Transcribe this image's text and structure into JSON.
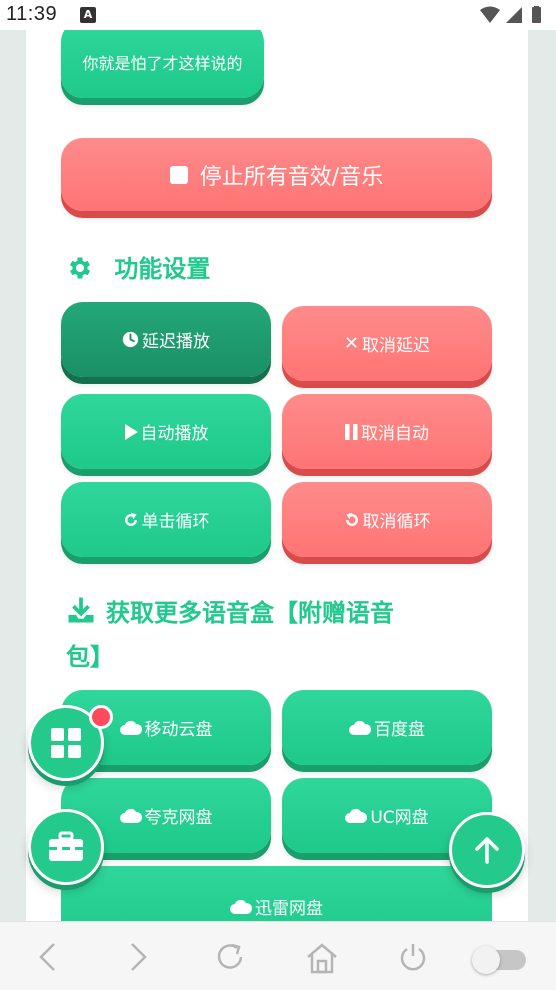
{
  "status": {
    "time": "11:39",
    "notif_letter": "A"
  },
  "top_button": {
    "label": "你就是怕了才这样说的"
  },
  "stop_button": {
    "icon": "stop-icon",
    "label": "停止所有音效/音乐"
  },
  "settings": {
    "title": "功能设置",
    "icon": "gear-icon",
    "buttons": [
      {
        "label": "延迟播放",
        "icon": "clock-icon",
        "color": "green-dark"
      },
      {
        "label": "取消延迟",
        "icon": "close-icon",
        "color": "red"
      },
      {
        "label": "自动播放",
        "icon": "play-icon",
        "color": "green"
      },
      {
        "label": "取消自动",
        "icon": "pause-icon",
        "color": "red"
      },
      {
        "label": "单击循环",
        "icon": "redo-icon",
        "color": "green"
      },
      {
        "label": "取消循环",
        "icon": "undo-icon",
        "color": "red"
      }
    ]
  },
  "downloads": {
    "title_line1": "获取更多语音盒【附赠语音",
    "title_line2": "包】",
    "icon": "download-icon",
    "buttons": [
      {
        "label": "移动云盘",
        "icon": "cloud-icon"
      },
      {
        "label": "百度盘",
        "icon": "cloud-icon"
      },
      {
        "label": "夸克网盘",
        "icon": "cloud-icon"
      },
      {
        "label": "UC网盘",
        "icon": "cloud-icon"
      },
      {
        "label": "迅雷网盘",
        "icon": "cloud-icon"
      }
    ]
  },
  "colors": {
    "accent": "#22c98d",
    "red": "#ff7b7b",
    "badge": "#ff4a5e"
  }
}
